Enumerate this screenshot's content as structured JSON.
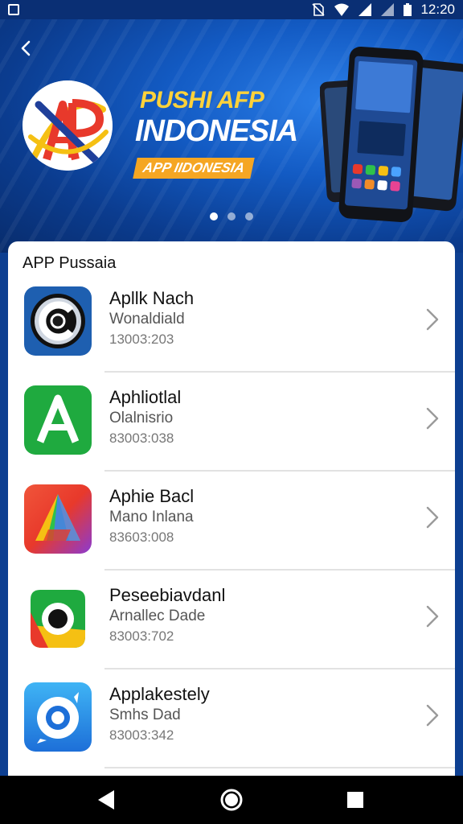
{
  "status_bar": {
    "time": "12:20",
    "icons": [
      "notification-icon",
      "no-sim-icon",
      "wifi-icon",
      "signal-icon",
      "signal-icon-2",
      "battery-icon"
    ]
  },
  "hero": {
    "title_line1": "PUSHI AFP",
    "title_line2": "INDONESIA",
    "tag": "APP IIDONESIA",
    "logo_text": "AP",
    "carousel_pages": 3,
    "carousel_active": 0
  },
  "section": {
    "title": "APP Pussaia"
  },
  "apps": [
    {
      "name": "Apllk Nach",
      "subtitle": "Wonaldiald",
      "meta": "13003:203",
      "icon": "camera-lens-app-icon"
    },
    {
      "name": "Aphliotlal",
      "subtitle": "Olalnisrio",
      "meta": "83003:038",
      "icon": "letter-a-app-icon"
    },
    {
      "name": "Aphie Bacl",
      "subtitle": "Mano Inlana",
      "meta": "83603:008",
      "icon": "colorful-triangle-app-icon"
    },
    {
      "name": "Peseebiavdanl",
      "subtitle": "Arnallec Dade",
      "meta": "83003:702",
      "icon": "green-circle-app-icon"
    },
    {
      "name": "Applakestely",
      "subtitle": "Smhs Dad",
      "meta": "83003:342",
      "icon": "blue-compass-app-icon"
    }
  ],
  "colors": {
    "hero_blue": "#135bc4",
    "accent_yellow": "#ffd23a",
    "tag_orange": "#f5a623"
  }
}
